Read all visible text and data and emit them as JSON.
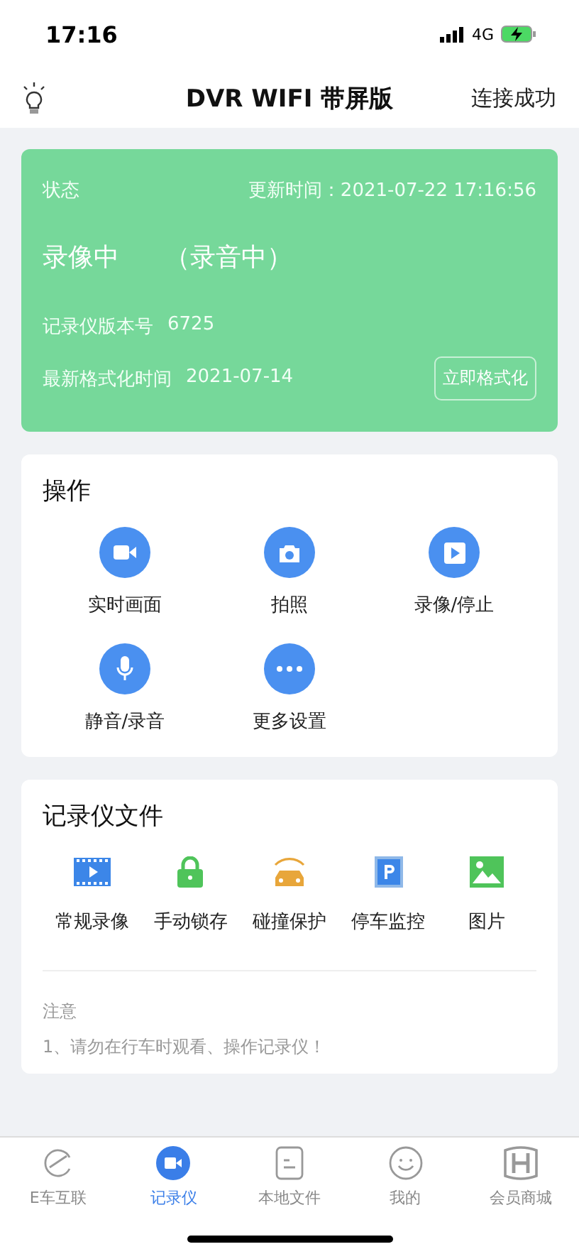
{
  "status_bar": {
    "time": "17:16",
    "network": "4G"
  },
  "header": {
    "title": "DVR WIFI 带屏版",
    "connection": "连接成功"
  },
  "status_card": {
    "label": "状态",
    "updated": "更新时间：2021-07-22 17:16:56",
    "recording": "录像中",
    "audio": "（录音中）",
    "version_label": "记录仪版本号",
    "version": "6725",
    "format_label": "最新格式化时间",
    "format_date": "2021-07-14",
    "format_button": "立即格式化"
  },
  "actions": {
    "title": "操作",
    "items": [
      {
        "kind": "video",
        "label": "实时画面"
      },
      {
        "kind": "camera",
        "label": "拍照"
      },
      {
        "kind": "play",
        "label": "录像/停止"
      },
      {
        "kind": "mic",
        "label": "静音/录音"
      },
      {
        "kind": "more",
        "label": "更多设置"
      }
    ]
  },
  "files": {
    "title": "记录仪文件",
    "items": [
      {
        "kind": "film",
        "label": "常规录像"
      },
      {
        "kind": "lock",
        "label": "手动锁存"
      },
      {
        "kind": "car",
        "label": "碰撞保护"
      },
      {
        "kind": "parking",
        "label": "停车监控"
      },
      {
        "kind": "image",
        "label": "图片"
      }
    ],
    "note_title": "注意",
    "notes": [
      "1、请勿在行车时观看、操作记录仪！"
    ]
  },
  "tabs": [
    {
      "kind": "e",
      "label": "E车互联",
      "selected": false
    },
    {
      "kind": "camera",
      "label": "记录仪",
      "selected": true
    },
    {
      "kind": "file",
      "label": "本地文件",
      "selected": false
    },
    {
      "kind": "smile",
      "label": "我的",
      "selected": false
    },
    {
      "kind": "h",
      "label": "会员商城",
      "selected": false
    }
  ]
}
